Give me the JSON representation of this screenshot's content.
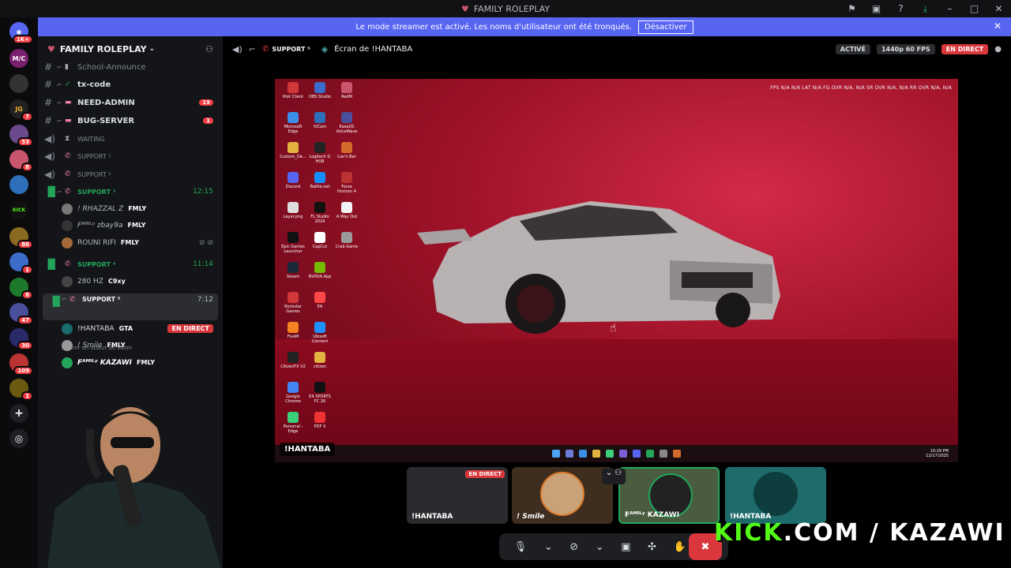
{
  "titlebar": {
    "title": "FAMILY ROLEPLAY"
  },
  "banner": {
    "message": "Le mode streamer est activé. Les noms d'utilisateur ont été tronqués.",
    "button": "Désactiver"
  },
  "server_rail": [
    {
      "label": "",
      "badge": "1K+"
    },
    {
      "label": "M/C",
      "badge": ""
    },
    {
      "label": "",
      "badge": ""
    },
    {
      "label": "JG",
      "badge": "7"
    },
    {
      "label": "",
      "badge": "53"
    },
    {
      "label": "",
      "badge": "8"
    },
    {
      "label": "",
      "badge": ""
    },
    {
      "label": "KICK",
      "badge": ""
    },
    {
      "label": "",
      "badge": "86"
    },
    {
      "label": "",
      "badge": "1"
    },
    {
      "label": "",
      "badge": "8"
    },
    {
      "label": "",
      "badge": "47"
    },
    {
      "label": "",
      "badge": "30"
    },
    {
      "label": "",
      "badge": "109"
    },
    {
      "label": "",
      "badge": "1"
    }
  ],
  "sidebar": {
    "server_name": "FAMILY ROLEPLAY",
    "channels": [
      {
        "name": "School-Announce",
        "badge": "",
        "muted": true
      },
      {
        "name": "tx-code",
        "badge": ""
      },
      {
        "name": "NEED-ADMIN",
        "badge": "19"
      },
      {
        "name": "BUG-SERVER",
        "badge": "1"
      }
    ],
    "voice": [
      {
        "name": "WAITING",
        "time": ""
      },
      {
        "name": "SUPPORT ¹",
        "time": ""
      },
      {
        "name": "SUPPORT ²",
        "time": ""
      },
      {
        "name": "SUPPORT ³",
        "time": "12:15"
      },
      {
        "name": "SUPPORT ⁴",
        "time": "11:14"
      },
      {
        "name": "SUPPORT ⁵",
        "time": "7:12"
      }
    ],
    "support3_users": [
      {
        "name": "! RHAZZAL Z",
        "tag": "FMLY"
      },
      {
        "name": "Fᴬᴹᴵᴸʸ zbay9a",
        "tag": "FMLY"
      },
      {
        "name": "ROUNI RIFI",
        "tag": "FMLY"
      }
    ],
    "support4_users": [
      {
        "name": "280 HZ",
        "tag": "C9xy"
      }
    ],
    "status_hint": "Définir un statut de salon",
    "support5_users": [
      {
        "name": "!HANTABA",
        "tag": "GTA",
        "live": "EN DIRECT"
      },
      {
        "name": "! Smile",
        "tag": "FMLY",
        "live": ""
      },
      {
        "name": "Fᴬᴹᴵᴸʸ KAZAWI",
        "tag": "FMLY",
        "live": ""
      }
    ]
  },
  "main": {
    "channel": "SUPPORT ⁵",
    "screen_title": "Écran de !HANTABA",
    "activity": "ACTIVÉ",
    "quality": "1440p 60 FPS",
    "live": "EN DIRECT"
  },
  "stream": {
    "osd": "FPS N/A N/A   LAT N/A   FG OVR N/A, N/A   SR OVR N/A, N/A   RR OVR N/A, N/A",
    "streamer_label": "!HANTABA",
    "desktop_icons": [
      "Riot Client",
      "OBS Studio",
      "RedM",
      "Microsoft Edge",
      "iVCam",
      "EaseUS VoiceWave",
      "Custom_De...",
      "Logitech G HUB",
      "Liar's Bar",
      "Discord",
      "Battle.net",
      "Forza Horizon 4",
      "Layar.png",
      "FL Studio 2024",
      "A Way Out",
      "Epic Games Launcher",
      "CapCut",
      "Crab Game",
      "Steam",
      "NVIDIA App",
      "",
      "Rockstar Games",
      "EA",
      "",
      "FiveM",
      "Ubisoft Connect",
      "",
      "CitizenFX V2",
      "citizen",
      "",
      "Google Chrome",
      "EA SPORTS FC 26",
      "",
      "Personal - Edge",
      "PDF X",
      ""
    ],
    "tray_time": "10:29 PM",
    "tray_date": "12/17/2025"
  },
  "tiles": [
    {
      "label": "!HANTABA",
      "live": "EN DIRECT"
    },
    {
      "label": "! Smile",
      "live": ""
    },
    {
      "label": "Fᴬᴹᴵᴸʸ KAZAWI",
      "live": ""
    },
    {
      "label": "!HANTABA",
      "live": ""
    }
  ],
  "overlay": {
    "kick_green": "KICK",
    "kick_white": ".COM / KAZAWI"
  },
  "colors": {
    "accent": "#5865f2",
    "live": "#da373c",
    "voice_green": "#23a55a",
    "kick": "#53fc18"
  }
}
